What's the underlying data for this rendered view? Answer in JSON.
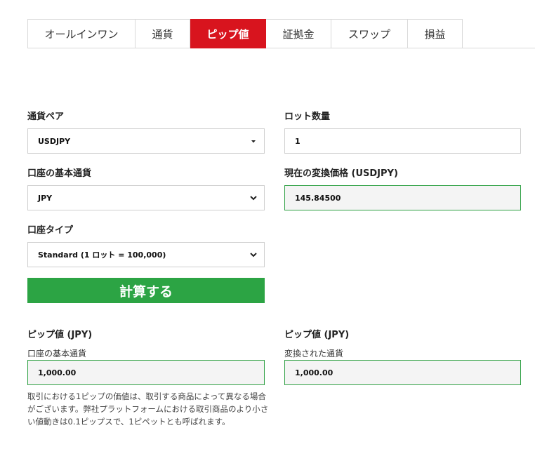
{
  "tabs": [
    {
      "label": "オールインワン"
    },
    {
      "label": "通貨"
    },
    {
      "label": "ピップ値"
    },
    {
      "label": "証拠金"
    },
    {
      "label": "スワップ"
    },
    {
      "label": "損益"
    }
  ],
  "form": {
    "currency_pair": {
      "label": "通貨ペア",
      "value": "USDJPY",
      "icon": "caret-down-icon"
    },
    "lot_qty": {
      "label": "ロット数量",
      "value": "1"
    },
    "base_currency": {
      "label": "口座の基本通貨",
      "value": "JPY",
      "icon": "chevron-down-icon"
    },
    "conversion_price": {
      "label": "現在の変換価格 (USDJPY)",
      "value": "145.84500"
    },
    "account_type": {
      "label": "口座タイプ",
      "value": "Standard (1 ロット = 100,000)",
      "icon": "chevron-down-icon"
    },
    "calculate_label": "計算する"
  },
  "results": {
    "left": {
      "title": "ピップ値 (JPY)",
      "sublabel": "口座の基本通貨",
      "value": "1,000.00"
    },
    "right": {
      "title": "ピップ値 (JPY)",
      "sublabel": "変換された通貨",
      "value": "1,000.00"
    }
  },
  "note": "取引における1ピップの価値は、取引する商品によって異なる場合がございます。弊社プラットフォームにおける取引商品のより小さい値動きは0.1ピップスで、1ピペットとも呼ばれます。",
  "colors": {
    "accent_red": "#d8141e",
    "accent_green": "#2ca444",
    "result_border": "#2ea043"
  }
}
